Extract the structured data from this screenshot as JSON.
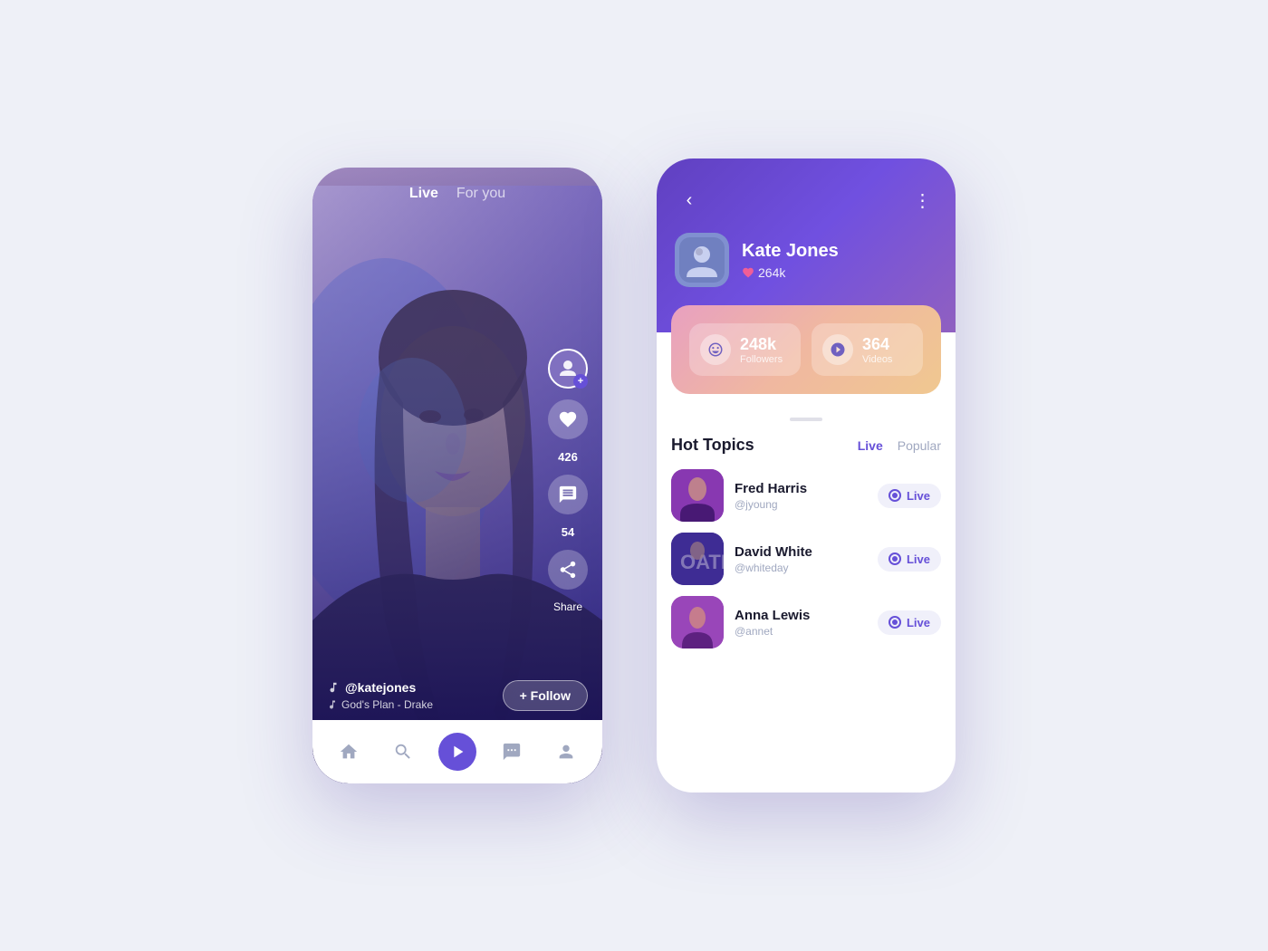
{
  "left_phone": {
    "nav": {
      "live": "Live",
      "for_you": "For you"
    },
    "like_count": "426",
    "comment_count": "54",
    "share_label": "Share",
    "username": "@katejones",
    "song": "God's Plan - Drake",
    "follow_btn": "+ Follow",
    "bottom_nav": [
      "home",
      "search",
      "play",
      "chat",
      "profile"
    ]
  },
  "right_phone": {
    "back_icon": "‹",
    "more_icon": "⋮",
    "profile": {
      "name": "Kate Jones",
      "likes": "264k"
    },
    "stats": {
      "followers_count": "248k",
      "followers_label": "Followers",
      "videos_count": "364",
      "videos_label": "Videos"
    },
    "hot_topics": {
      "title": "Hot Topics",
      "tabs": [
        "Live",
        "Popular"
      ],
      "active_tab": "Live",
      "items": [
        {
          "name": "Fred Harris",
          "handle": "@jyoung",
          "badge": "Live"
        },
        {
          "name": "David White",
          "handle": "@whiteday",
          "badge": "Live"
        },
        {
          "name": "Anna Lewis",
          "handle": "@annet",
          "badge": "Live"
        }
      ]
    }
  }
}
